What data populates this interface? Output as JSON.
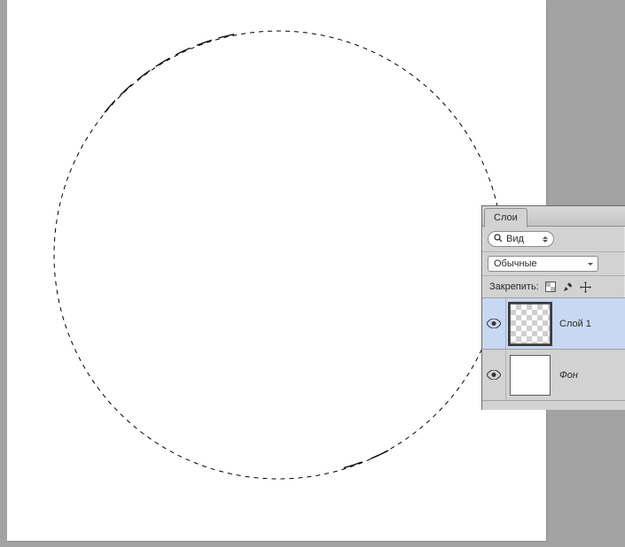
{
  "panel": {
    "tab_label": "Слои",
    "kind_label": "Вид",
    "blend_mode": "Обычные",
    "lock_label": "Закрепить:"
  },
  "layers": [
    {
      "name": "Слой 1",
      "visible": true,
      "selected": true,
      "transparent": true,
      "italic": false
    },
    {
      "name": "Фон",
      "visible": true,
      "selected": false,
      "transparent": false,
      "italic": true
    }
  ]
}
